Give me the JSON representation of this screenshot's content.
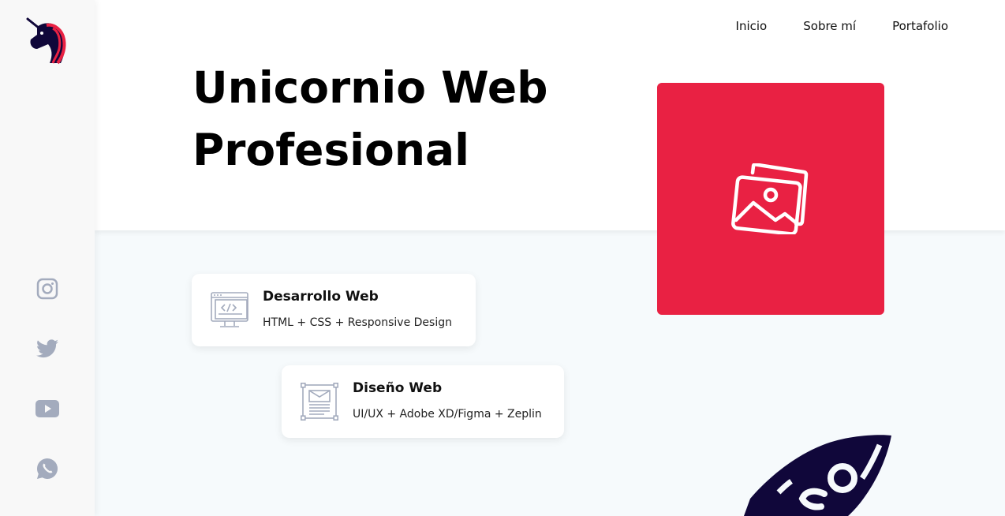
{
  "nav": {
    "items": [
      "Inicio",
      "Sobre mí",
      "Portafolio"
    ]
  },
  "hero": {
    "title_line1": "Unicornio Web",
    "title_line2": "Profesional"
  },
  "services": [
    {
      "title": "Desarrollo Web",
      "description": "HTML + CSS + Responsive Design",
      "icon": "web-code-icon"
    },
    {
      "title": "Diseño Web",
      "description": "UI/UX + Adobe XD/Figma + Zeplin",
      "icon": "wireframe-icon"
    }
  ],
  "social": [
    "instagram-icon",
    "twitter-icon",
    "youtube-icon",
    "whatsapp-icon"
  ],
  "colors": {
    "accent": "#e92143",
    "navy": "#10073a",
    "icon_gray": "#a3abbd",
    "sidebar_bg": "#f8f8f8",
    "section_bg": "#f6fafc"
  }
}
